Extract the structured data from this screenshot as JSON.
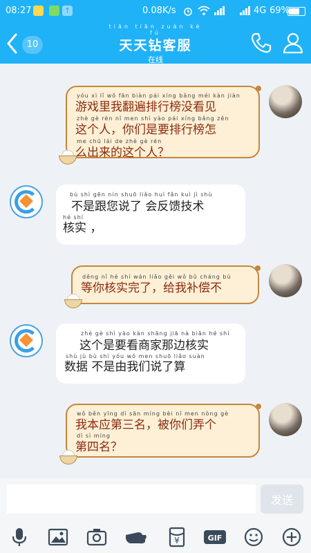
{
  "status_bar": {
    "time": "08:27",
    "network_speed": "0.08K/s",
    "network_type": "4G",
    "battery": "69%"
  },
  "header": {
    "back_badge": "10",
    "title_pinyin": "tiān tiān zuàn kè fú",
    "title": "天天钻客服",
    "status": "在线"
  },
  "messages": [
    {
      "sender": "user",
      "lines": [
        "游戏里我翻遍排行榜没看见",
        "这个人，你们是要排行榜怎",
        "么出来的这个人？"
      ],
      "pinyin": [
        "yóu  xì   lǐ   wǒ  fān biàn pái  xíng bǎng méi kàn  jiàn",
        "zhè  gè  rén        nǐ  men  shì  yào  pái xíng bǎng zěn",
        "me chū  lái  de  zhè  gè  rén"
      ]
    },
    {
      "sender": "service",
      "lines": [
        "不是跟您说了 会反馈技术",
        "核实 ，"
      ],
      "pinyin": [
        "bù   shì  gēn  nín shuō liǎo      huì  fǎn  kuì   jì  shù",
        "hé  shí"
      ]
    },
    {
      "sender": "user",
      "lines": [
        "等你核实完了，给我补偿不"
      ],
      "pinyin": [
        "děng  nǐ   hé  shí  wán liǎo       gěi  wǒ  bǔ cháng bù"
      ]
    },
    {
      "sender": "service",
      "lines": [
        "这个是要看商家那边核实",
        "数据 不是由我们说了算"
      ],
      "pinyin": [
        "zhè  gè  shì  yào kàn shāng jiā  nà  biān  hé   shí",
        "shù  jù      bù  shì  yóu  wǒ men shuō liǎo suàn"
      ]
    },
    {
      "sender": "user",
      "lines": [
        "我本应第三名，被你们弄个",
        "第四名？"
      ],
      "pinyin": [
        "wǒ  běn yīng  dì  sān míng       bèi  nǐ  men nòng  gè",
        "dì  sì míng"
      ]
    }
  ],
  "input": {
    "placeholder": "",
    "send_label": "发送"
  },
  "toolbar": {
    "items": [
      "microphone-icon",
      "image-icon",
      "camera-icon",
      "hand-icon",
      "red-packet-icon",
      "gif-icon",
      "emoji-icon",
      "plus-icon"
    ],
    "red_packet_symbol": "¥",
    "gif_label": "GIF"
  }
}
